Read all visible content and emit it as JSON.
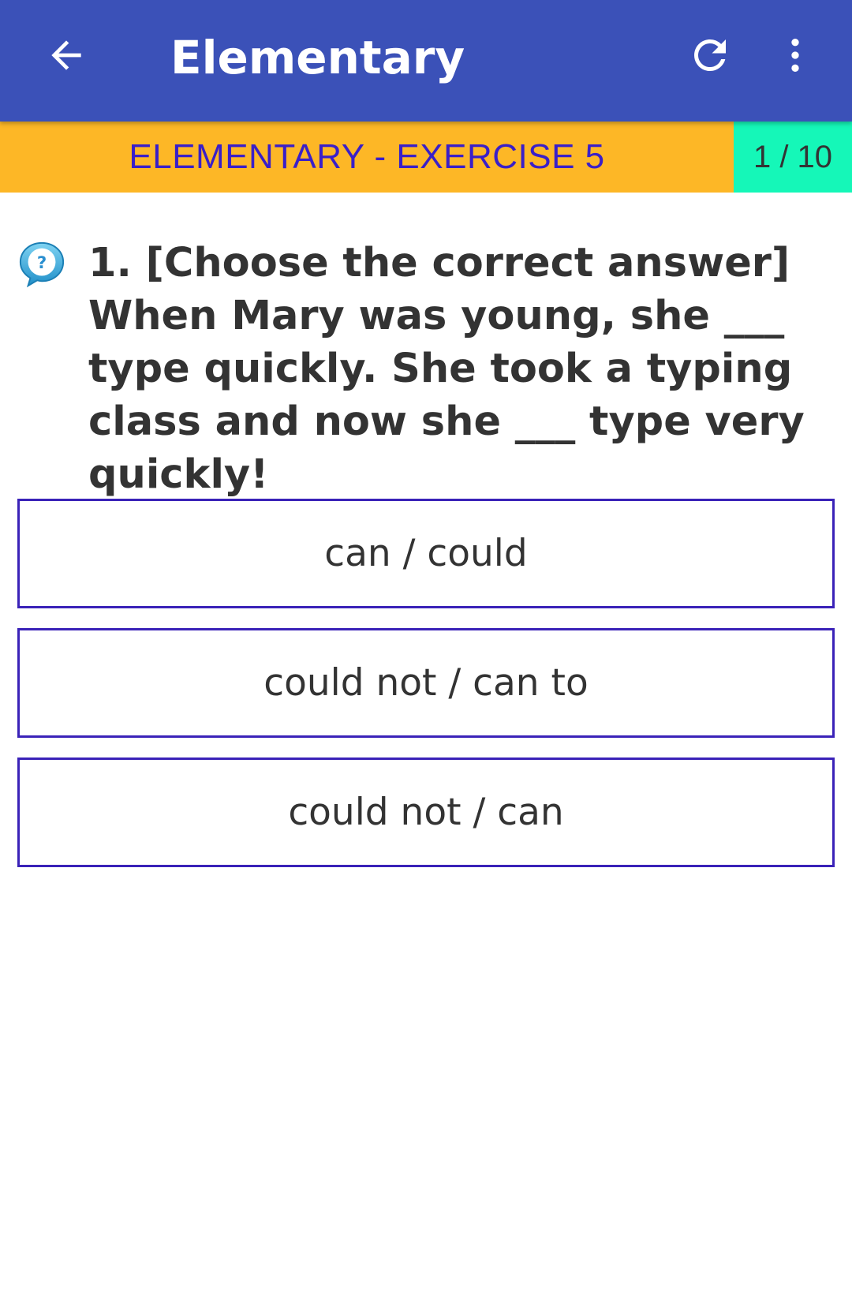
{
  "appbar": {
    "title": "Elementary",
    "icons": {
      "back": "arrow-back-icon",
      "refresh": "refresh-icon",
      "more": "more-vert-icon"
    },
    "color": "#3b51b8"
  },
  "exercise": {
    "title": "ELEMENTARY - EXERCISE 5",
    "counter": "1 / 10",
    "title_bg": "#fdb726",
    "counter_bg": "#15f7b8",
    "title_color": "#3a1fc8"
  },
  "question": {
    "icon": "question-bubble-icon",
    "text": "1. [Choose the correct answer] When Mary was young, she ___ type quickly. She took a typing class and now she ___ type very quickly!"
  },
  "answers": [
    {
      "label": "can / could"
    },
    {
      "label": "could not / can to"
    },
    {
      "label": "could not / can"
    }
  ],
  "answer_border_color": "#3a22b8"
}
